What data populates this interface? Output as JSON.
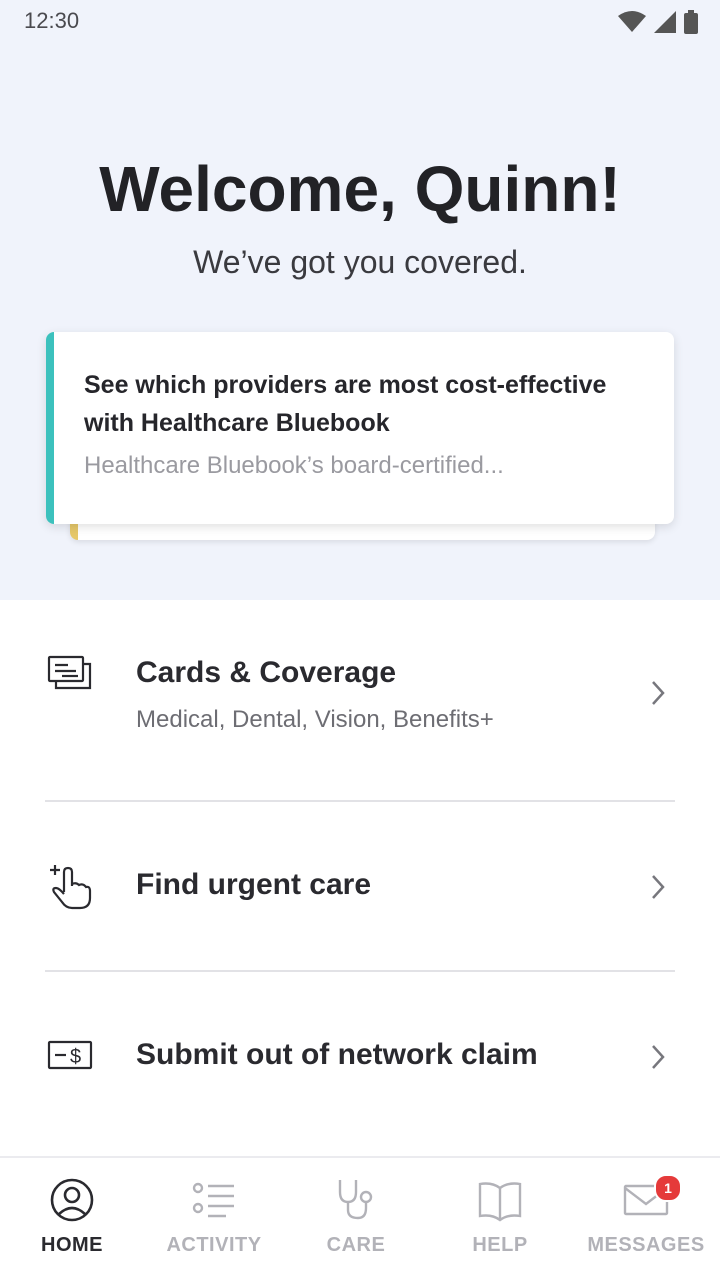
{
  "status_bar": {
    "time": "12:30",
    "icons": [
      "wifi-icon",
      "signal-icon",
      "battery-icon"
    ]
  },
  "hero": {
    "title": "Welcome, Quinn!",
    "subtitle": "We’ve got you covered."
  },
  "promo_card": {
    "title": "See which providers are most cost-effective with Healthcare Bluebook",
    "body": "Healthcare Bluebook’s board-certified...",
    "accent_color": "#3cc1bd",
    "stack_accent_color": "#e6c86a"
  },
  "menu": [
    {
      "icon": "id-cards-icon",
      "title": "Cards & Coverage",
      "subtitle": "Medical, Dental, Vision, Benefits+"
    },
    {
      "icon": "urgent-care-hand-icon",
      "title": "Find urgent care"
    },
    {
      "icon": "claim-money-icon",
      "title": "Submit out of network claim"
    }
  ],
  "bottom_nav": {
    "items": [
      {
        "label": "HOME",
        "icon": "person-circle-icon",
        "active": true
      },
      {
        "label": "ACTIVITY",
        "icon": "list-icon",
        "active": false
      },
      {
        "label": "CARE",
        "icon": "stethoscope-icon",
        "active": false
      },
      {
        "label": "HELP",
        "icon": "book-icon",
        "active": false
      },
      {
        "label": "MESSAGES",
        "icon": "envelope-icon",
        "active": false
      }
    ],
    "messages_badge": "1"
  },
  "colors": {
    "hero_bg": "#f0f3fb",
    "active_nav": "#2a2a2f",
    "inactive_nav": "#b2b2b8",
    "badge": "#e53a3a"
  }
}
